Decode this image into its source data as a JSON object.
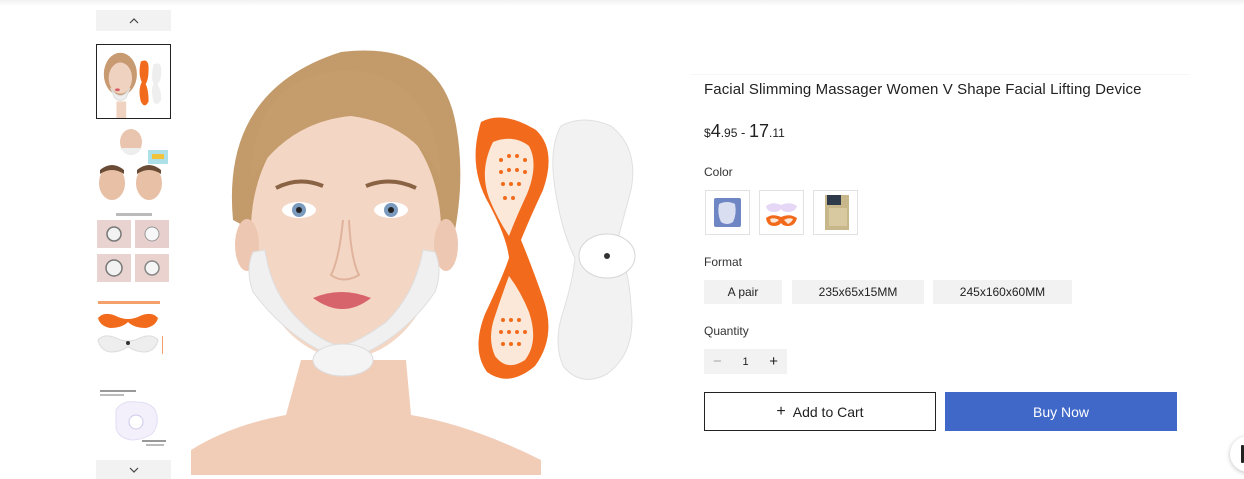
{
  "product": {
    "title": "Facial Slimming Massager Women V Shape Facial Lifting Device",
    "price": {
      "currency": "$",
      "min_int": "4",
      "min_dec": ".95",
      "separator": " - ",
      "max_int": "17",
      "max_dec": ".11"
    }
  },
  "gallery": {
    "up_icon": "chevron-up-icon",
    "down_icon": "chevron-down-icon",
    "thumbnail_count": 5,
    "active_thumbnail": 1
  },
  "options": {
    "color": {
      "label": "Color",
      "swatches": [
        "blue-white-device",
        "orange-pad",
        "boxed-device"
      ]
    },
    "format": {
      "label": "Format",
      "values": [
        "A pair",
        "235x65x15MM",
        "245x160x60MM"
      ]
    }
  },
  "quantity": {
    "label": "Quantity",
    "value": "1",
    "minus": "−",
    "plus": "+"
  },
  "actions": {
    "add_to_cart_icon": "+",
    "add_to_cart": "Add to Cart",
    "buy_now": "Buy Now"
  },
  "colors": {
    "buy_now_bg": "#3f68c8",
    "pad_orange": "#f26b1d",
    "thumb_bg": "#f2f2f2"
  }
}
